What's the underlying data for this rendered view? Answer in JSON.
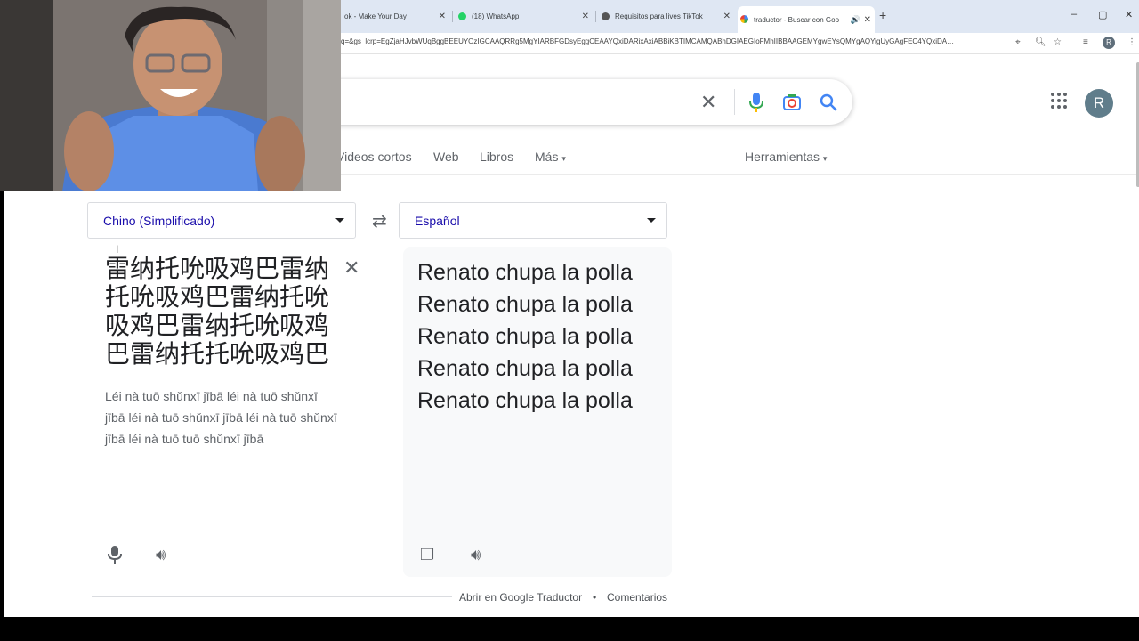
{
  "tabs": [
    {
      "title": "ok - Make Your Day",
      "close": "✕"
    },
    {
      "title": "(18) WhatsApp",
      "close": "✕"
    },
    {
      "title": "Requisitos para lives TikTok",
      "close": "✕"
    },
    {
      "title": "traductor - Buscar con Goo",
      "close": "✕",
      "active": true
    }
  ],
  "new_tab": "+",
  "window_controls": [
    "–",
    "▢",
    "✕"
  ],
  "url": "q=&gs_lcrp=EgZjaHJvbWUqBggBEEUYOzIGCAAQRRg5MgYIARBFGDsyEggCEAAYQxiDARixAxiABBiKBTIMCAMQABhDGIAEGIoFMhIIBBAAGEMYgwEYsQMYgAQYigUyGAgFEC4YQxiDA…",
  "profile_initial_small": "R",
  "search": {
    "clear": "✕",
    "mic": "mic",
    "lens": "lens",
    "search": "search"
  },
  "avatar_initial": "R",
  "nav": {
    "videos": "Videos cortos",
    "web": "Web",
    "books": "Libros",
    "more": "Más",
    "tools": "Herramientas"
  },
  "translator": {
    "source_lang": "Chino (Simplificado)",
    "target_lang": "Español",
    "source_text": "雷纳托吮吸鸡巴雷纳托吮吸鸡巴雷纳托吮吸鸡巴雷纳托吮吸鸡巴雷纳托托吮吸鸡巴",
    "transliteration": "Léi nà tuō shǔnxī jībā léi nà tuō shǔnxī jībā léi nà tuō shǔnxī jībā léi nà tuō shǔnxī jībā léi nà tuō tuō shǔnxī jībā",
    "target_text": "Renato chupa la polla Renato chupa la polla Renato chupa la polla Renato chupa la polla Renato chupa la polla"
  },
  "footer": {
    "open_link": "Abrir en Google Traductor",
    "dot": "•",
    "feedback": "Comentarios"
  },
  "colors": {
    "link_blue": "#1a0dab",
    "tabstrip": "#dfe7f3",
    "avatar": "#607d8b"
  }
}
